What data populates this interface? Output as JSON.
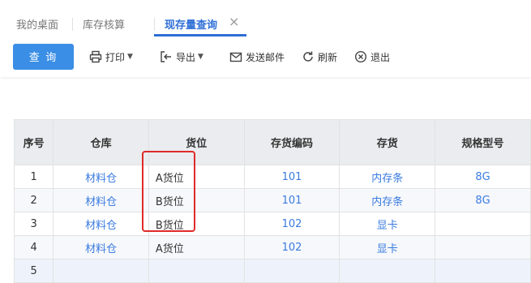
{
  "tabs": [
    {
      "label": "我的桌面"
    },
    {
      "label": "库存核算"
    },
    {
      "label": "现存量查询",
      "active": true
    }
  ],
  "toolbar": {
    "query_label": "查 询",
    "print_label": "打印",
    "export_label": "导出",
    "email_label": "发送邮件",
    "refresh_label": "刷新",
    "exit_label": "退出"
  },
  "table": {
    "columns": [
      "序号",
      "仓库",
      "货位",
      "存货编码",
      "存货",
      "规格型号"
    ],
    "rows": [
      [
        "1",
        "材料仓",
        "A货位",
        "101",
        "内存条",
        "8G"
      ],
      [
        "2",
        "材料仓",
        "B货位",
        "101",
        "内存条",
        "8G"
      ],
      [
        "3",
        "材料仓",
        "B货位",
        "102",
        "显卡",
        ""
      ],
      [
        "4",
        "材料仓",
        "A货位",
        "102",
        "显卡",
        ""
      ],
      [
        "5",
        "",
        "",
        "",
        "",
        ""
      ]
    ]
  },
  "colors": {
    "accent": "#3a8ee6",
    "link": "#3a7be0",
    "highlight_box": "#e02a2a",
    "header_bg": "#eaecef"
  }
}
